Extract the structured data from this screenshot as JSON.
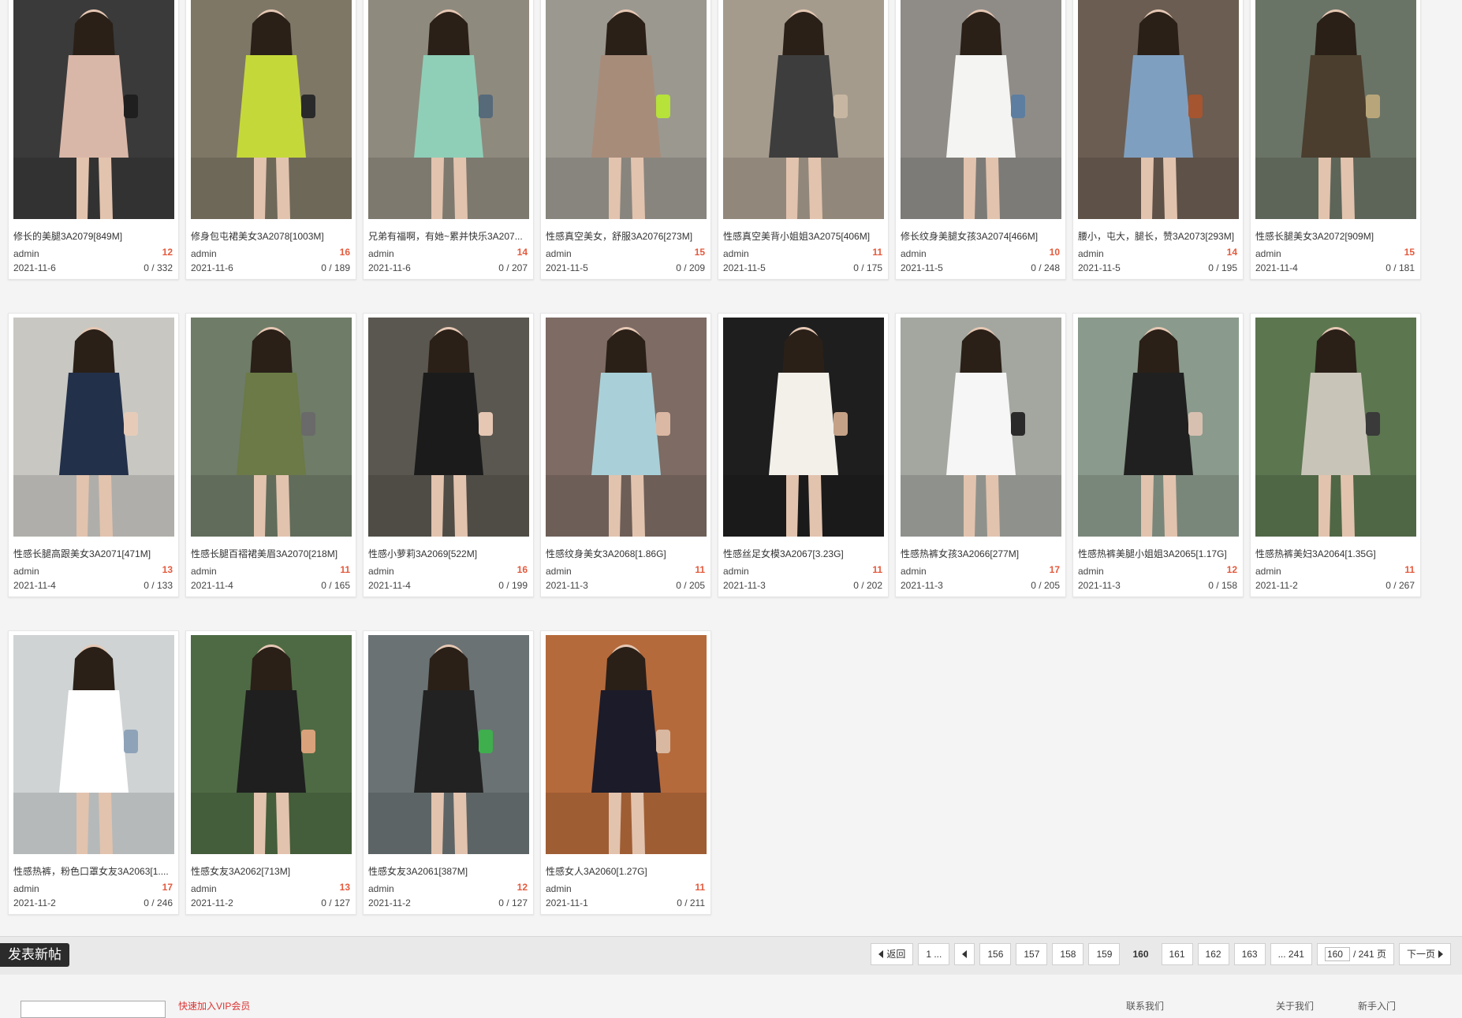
{
  "cards": [
    {
      "title": "修长的美腿3A2079[849M]",
      "author": "admin",
      "badge": "12",
      "date": "2021-11-6",
      "stats": "0 / 332",
      "colors": [
        "#3a3a3a",
        "#d9b7a8",
        "#1f1f1f"
      ]
    },
    {
      "title": "修身包屯裙美女3A2078[1003M]",
      "author": "admin",
      "badge": "16",
      "date": "2021-11-6",
      "stats": "0 / 189",
      "colors": [
        "#7e7766",
        "#c5d83a",
        "#2a2a2a"
      ]
    },
    {
      "title": "兄弟有福啊，有她~累并快乐3A207...",
      "author": "admin",
      "badge": "14",
      "date": "2021-11-6",
      "stats": "0 / 207",
      "colors": [
        "#8f8a7e",
        "#8fcfb8",
        "#566a7a"
      ]
    },
    {
      "title": "性感真空美女，舒服3A2076[273M]",
      "author": "admin",
      "badge": "15",
      "date": "2021-11-5",
      "stats": "0 / 209",
      "colors": [
        "#9b9890",
        "#a88c7a",
        "#b6e23a"
      ]
    },
    {
      "title": "性感真空美背小姐姐3A2075[406M]",
      "author": "admin",
      "badge": "11",
      "date": "2021-11-5",
      "stats": "0 / 175",
      "colors": [
        "#a59b8d",
        "#3d3d3d",
        "#c7b7a2"
      ]
    },
    {
      "title": "修长纹身美腿女孩3A2074[466M]",
      "author": "admin",
      "badge": "10",
      "date": "2021-11-5",
      "stats": "0 / 248",
      "colors": [
        "#8f8c88",
        "#f4f4f2",
        "#5d7ea0"
      ]
    },
    {
      "title": "腰小，屯大，腿长，赞3A2073[293M]",
      "author": "admin",
      "badge": "14",
      "date": "2021-11-5",
      "stats": "0 / 195",
      "colors": [
        "#6b5d52",
        "#7f9fc0",
        "#a5552f"
      ]
    },
    {
      "title": "性感长腿美女3A2072[909M]",
      "author": "admin",
      "badge": "15",
      "date": "2021-11-4",
      "stats": "0 / 181",
      "colors": [
        "#6a7466",
        "#4b3e2e",
        "#b8a67a"
      ]
    },
    {
      "title": "性感长腿高跟美女3A2071[471M]",
      "author": "admin",
      "badge": "13",
      "date": "2021-11-4",
      "stats": "0 / 133",
      "colors": [
        "#c8c7c2",
        "#22304a",
        "#e6ccb8"
      ]
    },
    {
      "title": "性感长腿百褶裙美眉3A2070[218M]",
      "author": "admin",
      "badge": "11",
      "date": "2021-11-4",
      "stats": "0 / 165",
      "colors": [
        "#6f7c68",
        "#6b7a46",
        "#6a6a6a"
      ]
    },
    {
      "title": "性感小萝莉3A2069[522M]",
      "author": "admin",
      "badge": "16",
      "date": "2021-11-4",
      "stats": "0 / 199",
      "colors": [
        "#5a5750",
        "#1b1b1b",
        "#e5c7b3"
      ]
    },
    {
      "title": "性感纹身美女3A2068[1.86G]",
      "author": "admin",
      "badge": "11",
      "date": "2021-11-3",
      "stats": "0 / 205",
      "colors": [
        "#7d6b64",
        "#a9d0d8",
        "#dbb8a4"
      ]
    },
    {
      "title": "性感丝足女模3A2067[3.23G]",
      "author": "admin",
      "badge": "11",
      "date": "2021-11-3",
      "stats": "0 / 202",
      "colors": [
        "#1e1e1e",
        "#f3f0ea",
        "#c5a287"
      ]
    },
    {
      "title": "性感热裤女孩3A2066[277M]",
      "author": "admin",
      "badge": "17",
      "date": "2021-11-3",
      "stats": "0 / 205",
      "colors": [
        "#a3a7a0",
        "#f6f6f6",
        "#2a2a2a"
      ]
    },
    {
      "title": "性感热裤美腿小姐姐3A2065[1.17G]",
      "author": "admin",
      "badge": "12",
      "date": "2021-11-3",
      "stats": "0 / 158",
      "colors": [
        "#8a9a8c",
        "#202020",
        "#d8c0b0"
      ]
    },
    {
      "title": "性感热裤美妇3A2064[1.35G]",
      "author": "admin",
      "badge": "11",
      "date": "2021-11-2",
      "stats": "0 / 267",
      "colors": [
        "#5c7650",
        "#c9c4b8",
        "#3a3a3a"
      ]
    },
    {
      "title": "性感热裤，粉色口罩女友3A2063[1....",
      "author": "admin",
      "badge": "17",
      "date": "2021-11-2",
      "stats": "0 / 246",
      "colors": [
        "#cfd3d4",
        "#ffffff",
        "#8fa3b8"
      ]
    },
    {
      "title": "性感女友3A2062[713M]",
      "author": "admin",
      "badge": "13",
      "date": "2021-11-2",
      "stats": "0 / 127",
      "colors": [
        "#4e6a44",
        "#1f1f1f",
        "#d9a27a"
      ]
    },
    {
      "title": "性感女友3A2061[387M]",
      "author": "admin",
      "badge": "12",
      "date": "2021-11-2",
      "stats": "0 / 127",
      "colors": [
        "#6a7274",
        "#222222",
        "#3fae4d"
      ]
    },
    {
      "title": "性感女人3A2060[1.27G]",
      "author": "admin",
      "badge": "11",
      "date": "2021-11-1",
      "stats": "0 / 211",
      "colors": [
        "#b56a3c",
        "#1b1b2a",
        "#d8b8a0"
      ]
    }
  ],
  "new_post_label": "发表新帖",
  "pager": {
    "back": "返回",
    "first": "1 ...",
    "pages": [
      "156",
      "157",
      "158",
      "159"
    ],
    "current": "160",
    "next_pages": [
      "161",
      "162",
      "163"
    ],
    "last": "... 241",
    "input_value": "160",
    "total": "/ 241 页",
    "next": "下一页"
  },
  "footer": {
    "left_text": "快速加入VIP会员",
    "right_1": "联系我们",
    "right_2": "关于我们",
    "right_3": "新手入门"
  }
}
